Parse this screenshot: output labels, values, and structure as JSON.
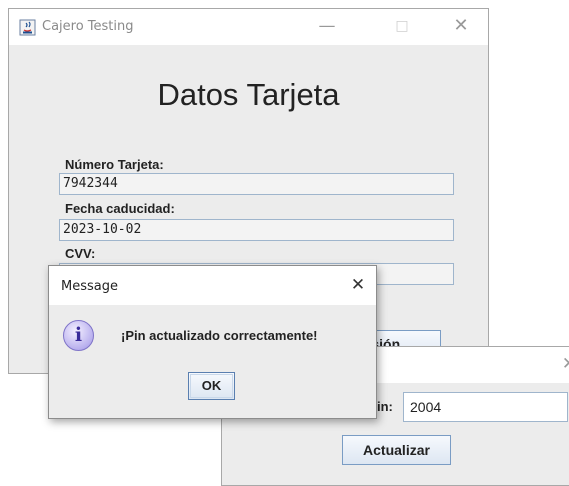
{
  "main_window": {
    "title": "Cajero Testing",
    "window_controls": {
      "minimize": "—",
      "maximize": "□",
      "close": "✕"
    },
    "heading": "Datos Tarjeta",
    "fields": [
      {
        "label": "Número Tarjeta:",
        "value": "7942344"
      },
      {
        "label": "Fecha caducidad:",
        "value": "2023-10-02"
      },
      {
        "label": "CVV:",
        "value": ""
      }
    ],
    "partial_button_label": "sesión"
  },
  "pin_window": {
    "close": "✕",
    "pin_label_partial": "in:",
    "pin_value": "2004",
    "update_button": "Actualizar"
  },
  "message_dialog": {
    "title": "Message",
    "close": "✕",
    "icon": "information-icon",
    "icon_glyph": "i",
    "message": "¡Pin actualizado correctamente!",
    "ok_button": "OK"
  }
}
